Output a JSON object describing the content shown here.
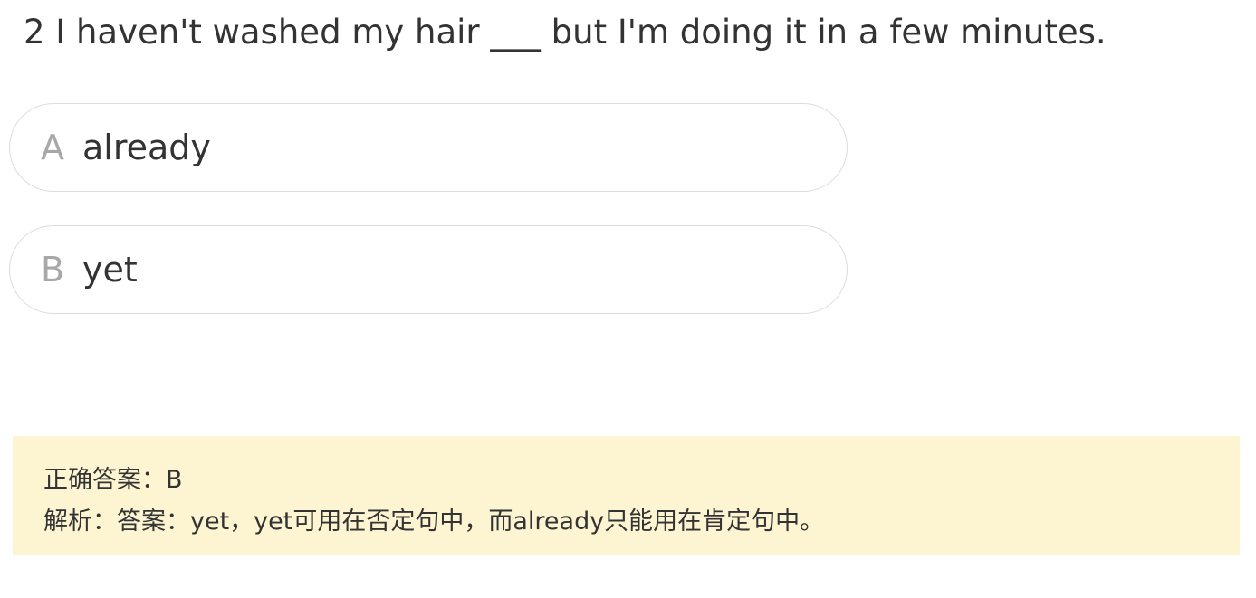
{
  "question": {
    "text": "2 I haven't washed my hair ___ but I'm doing it in a few minutes."
  },
  "options": [
    {
      "letter": "A",
      "text": "already"
    },
    {
      "letter": "B",
      "text": "yet"
    }
  ],
  "answer": {
    "correct_line": "正确答案：B",
    "analysis_line": "解析：答案：yet，yet可用在否定句中，而already只能用在肯定句中。"
  }
}
